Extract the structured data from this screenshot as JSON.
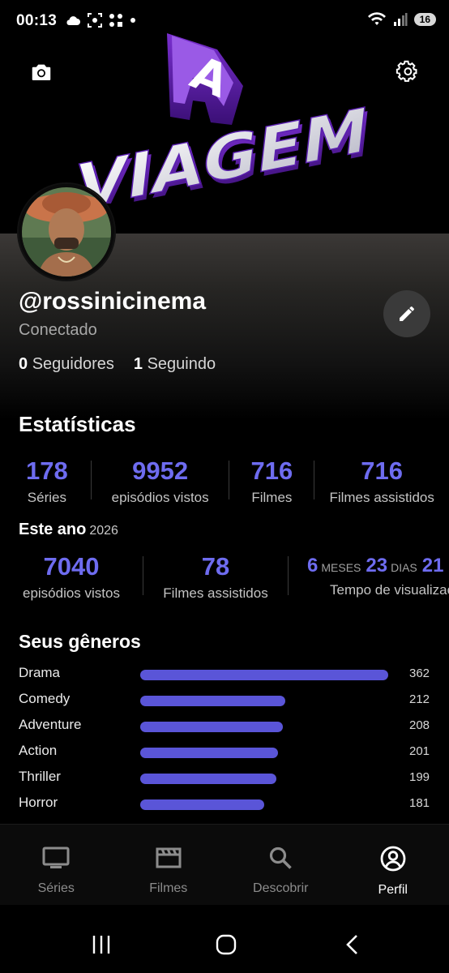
{
  "status_bar": {
    "time": "00:13",
    "battery": "16"
  },
  "banner": {
    "art_text_top": "A",
    "art_text_main": "VIAGEM"
  },
  "profile": {
    "username": "@rossinicinema",
    "status": "Conectado",
    "followers_count": "0",
    "followers_label": "Seguidores",
    "following_count": "1",
    "following_label": "Seguindo"
  },
  "stats": {
    "title": "Estatísticas",
    "items": [
      {
        "value": "178",
        "label": "Séries"
      },
      {
        "value": "9952",
        "label": "episódios vistos"
      },
      {
        "value": "716",
        "label": "Filmes"
      },
      {
        "value": "716",
        "label": "Filmes assistidos"
      }
    ]
  },
  "this_year": {
    "title": "Este ano",
    "year": "2026",
    "items": [
      {
        "value": "7040",
        "label": "episódios vistos"
      },
      {
        "value": "78",
        "label": "Filmes assistidos"
      }
    ],
    "watch_time": {
      "months": "6",
      "months_unit": "MESES",
      "days": "23",
      "days_unit": "DIAS",
      "hours": "21",
      "label": "Tempo de visualização"
    }
  },
  "genres": {
    "title": "Seus gêneros",
    "items": [
      {
        "name": "Drama",
        "count": 362
      },
      {
        "name": "Comedy",
        "count": 212
      },
      {
        "name": "Adventure",
        "count": 208
      },
      {
        "name": "Action",
        "count": 201
      },
      {
        "name": "Thriller",
        "count": 199
      },
      {
        "name": "Horror",
        "count": 181
      }
    ]
  },
  "nav": {
    "items": [
      {
        "label": "Séries",
        "icon": "tv-icon"
      },
      {
        "label": "Filmes",
        "icon": "clapperboard-icon"
      },
      {
        "label": "Descobrir",
        "icon": "search-icon"
      },
      {
        "label": "Perfil",
        "icon": "profile-icon"
      }
    ],
    "active": "Perfil"
  },
  "colors": {
    "accent": "#6e6cf0",
    "bar": "#5a55d8",
    "background": "#000000"
  }
}
